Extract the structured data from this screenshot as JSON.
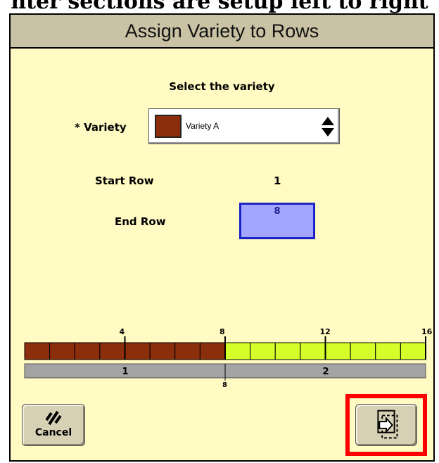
{
  "caption": "nter sections are setup left to right",
  "window": {
    "title": "Assign Variety to Rows"
  },
  "form": {
    "prompt": "Select the variety",
    "variety_label": "* Variety",
    "variety_value": "Variety A",
    "variety_color": "#8b2e0c",
    "start_row_label": "Start Row",
    "start_row_value": "1",
    "end_row_label": "End Row",
    "end_row_value": "8"
  },
  "row_map": {
    "total_rows": 16,
    "tick_labels": [
      "4",
      "8",
      "12",
      "16"
    ],
    "assigned_rows": 8,
    "assigned_color": "#8b2e0c",
    "unassigned_color": "#d4ff2a",
    "sections": [
      {
        "label": "1"
      },
      {
        "label": "2"
      }
    ],
    "section_split_label": "8"
  },
  "buttons": {
    "cancel_label": "Cancel",
    "cancel_icon": "cancel-slash-icon",
    "next_icon": "next-page-icon",
    "highlight_color": "#ff0000"
  }
}
